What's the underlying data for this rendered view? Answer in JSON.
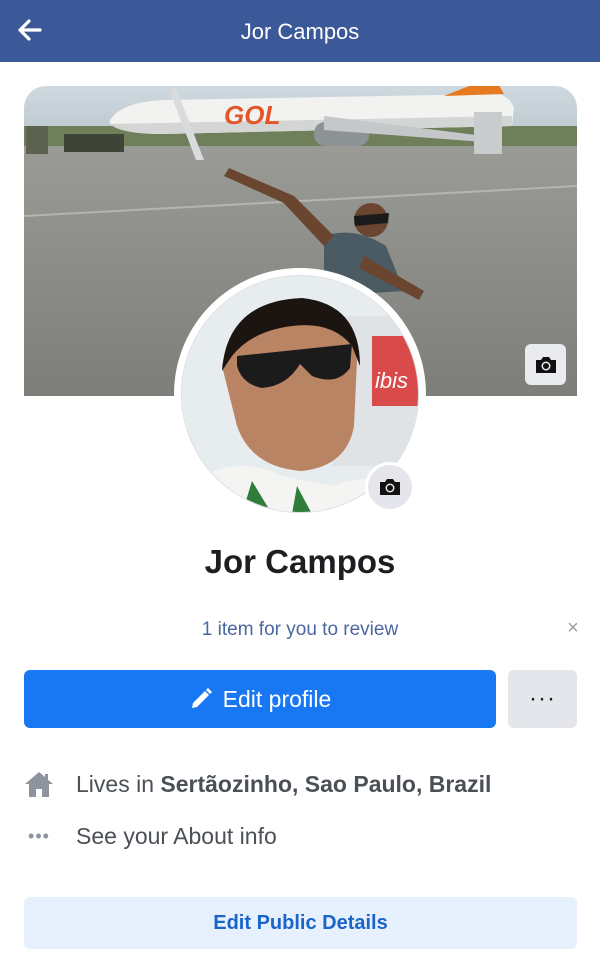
{
  "header": {
    "title": "Jor Campos",
    "back_icon": "arrow-left-icon",
    "background": "#3b5998"
  },
  "cover_photo": {
    "camera_icon": "camera-icon",
    "logo_text": "GOL"
  },
  "profile_photo": {
    "camera_icon": "camera-icon",
    "sign_text": "ibis"
  },
  "profile": {
    "name": "Jor Campos"
  },
  "review": {
    "text": "1 item for you to review",
    "close": "×"
  },
  "actions": {
    "edit_profile_label": "Edit profile",
    "edit_icon": "pencil-icon",
    "more_label": "···",
    "accent": "#1877f2"
  },
  "details": {
    "lives_prefix": "Lives in",
    "lives_place": "Sertãozinho, Sao Paulo, Brazil",
    "home_icon": "home-icon",
    "about_label": "See your About info",
    "about_icon": "more-dots-icon",
    "about_dots": "•••"
  },
  "public_details": {
    "label": "Edit Public Details"
  }
}
